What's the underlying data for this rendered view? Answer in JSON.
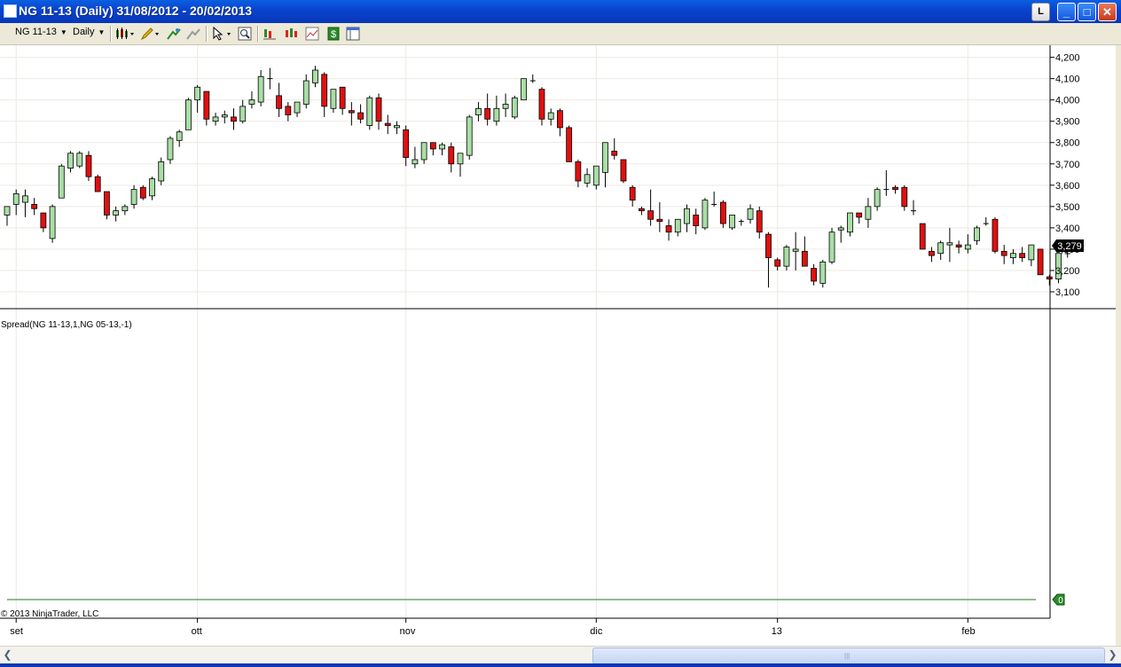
{
  "window": {
    "title": "NG 11-13 (Daily)  31/08/2012 - 20/02/2013",
    "l_button": "L",
    "minimize_glyph": "_",
    "maximize_glyph": "□",
    "close_glyph": "✕"
  },
  "toolbar": {
    "instrument": "NG 11-13",
    "interval": "Daily",
    "icons": [
      "candlestick-chart-icon",
      "pencil-draw-icon",
      "add-indicator-icon",
      "strategy-icon",
      "cursor-pointer-icon",
      "zoom-icon",
      "data-series-icon",
      "indicators-icon",
      "strategies-icon",
      "dollar-icon",
      "properties-icon"
    ]
  },
  "panels": {
    "spread_label": "Spread(NG 11-13,1,NG 05-13,-1)",
    "copyright": "© 2013 NinjaTrader, LLC",
    "spread_zero_label": "0"
  },
  "colors": {
    "up_candle": "#a9dea6",
    "down_candle": "#e01010",
    "spread_line": "#1f7a1f",
    "last_price_bg": "#000000",
    "titlebar": "#0a44d0"
  },
  "chart_data": {
    "type": "candlestick",
    "ylim": [
      3050,
      4240
    ],
    "y_ticks": [
      "4,200",
      "4,100",
      "4,000",
      "3,900",
      "3,800",
      "3,700",
      "3,600",
      "3,500",
      "3,400",
      "3,300",
      "3,200",
      "3,100"
    ],
    "y_tick_values": [
      4200,
      4100,
      4000,
      3900,
      3800,
      3700,
      3600,
      3500,
      3400,
      3300,
      3200,
      3100
    ],
    "last_price": 3279,
    "last_price_label": "3,279",
    "x_labels": [
      "set",
      "ott",
      "nov",
      "dic",
      "13",
      "feb"
    ],
    "x_label_bar_index": [
      1,
      21,
      44,
      65,
      85,
      106
    ],
    "candles": [
      [
        3460,
        3500,
        3410,
        3500
      ],
      [
        3510,
        3580,
        3460,
        3560
      ],
      [
        3520,
        3580,
        3450,
        3550
      ],
      [
        3510,
        3540,
        3460,
        3490
      ],
      [
        3470,
        3470,
        3380,
        3400
      ],
      [
        3350,
        3510,
        3330,
        3500
      ],
      [
        3540,
        3700,
        3540,
        3690
      ],
      [
        3680,
        3760,
        3660,
        3750
      ],
      [
        3690,
        3760,
        3680,
        3750
      ],
      [
        3740,
        3760,
        3620,
        3640
      ],
      [
        3640,
        3650,
        3570,
        3570
      ],
      [
        3570,
        3570,
        3440,
        3460
      ],
      [
        3460,
        3500,
        3430,
        3480
      ],
      [
        3480,
        3510,
        3460,
        3500
      ],
      [
        3510,
        3600,
        3490,
        3580
      ],
      [
        3590,
        3600,
        3530,
        3540
      ],
      [
        3550,
        3640,
        3530,
        3630
      ],
      [
        3620,
        3730,
        3600,
        3710
      ],
      [
        3720,
        3830,
        3700,
        3820
      ],
      [
        3810,
        3860,
        3780,
        3850
      ],
      [
        3860,
        4010,
        3860,
        4000
      ],
      [
        4000,
        4070,
        3940,
        4060
      ],
      [
        4040,
        4040,
        3880,
        3910
      ],
      [
        3900,
        3940,
        3880,
        3920
      ],
      [
        3920,
        3950,
        3890,
        3930
      ],
      [
        3920,
        3960,
        3860,
        3900
      ],
      [
        3900,
        4000,
        3890,
        3970
      ],
      [
        3980,
        4040,
        3960,
        4000
      ],
      [
        3990,
        4140,
        3970,
        4110
      ],
      [
        4100,
        4150,
        4050,
        4100
      ],
      [
        4020,
        4080,
        3920,
        3960
      ],
      [
        3970,
        3990,
        3900,
        3930
      ],
      [
        3940,
        3990,
        3920,
        3990
      ],
      [
        3980,
        4120,
        3960,
        4090
      ],
      [
        4080,
        4160,
        4060,
        4140
      ],
      [
        4120,
        4130,
        3920,
        3970
      ],
      [
        3960,
        4050,
        3940,
        4050
      ],
      [
        4060,
        4060,
        3930,
        3960
      ],
      [
        3950,
        3990,
        3880,
        3940
      ],
      [
        3940,
        3980,
        3890,
        3910
      ],
      [
        3880,
        4020,
        3860,
        4010
      ],
      [
        4010,
        4030,
        3860,
        3900
      ],
      [
        3890,
        3930,
        3840,
        3880
      ],
      [
        3870,
        3900,
        3840,
        3880
      ],
      [
        3860,
        3880,
        3690,
        3730
      ],
      [
        3700,
        3780,
        3680,
        3720
      ],
      [
        3720,
        3800,
        3700,
        3800
      ],
      [
        3800,
        3800,
        3740,
        3770
      ],
      [
        3770,
        3800,
        3740,
        3790
      ],
      [
        3780,
        3800,
        3660,
        3700
      ],
      [
        3700,
        3740,
        3640,
        3750
      ],
      [
        3740,
        3930,
        3720,
        3920
      ],
      [
        3930,
        3990,
        3900,
        3960
      ],
      [
        3960,
        4030,
        3880,
        3910
      ],
      [
        3900,
        4020,
        3880,
        3960
      ],
      [
        3960,
        4030,
        3920,
        3980
      ],
      [
        3920,
        4020,
        3910,
        4010
      ],
      [
        4000,
        4100,
        4000,
        4100
      ],
      [
        4090,
        4120,
        4080,
        4090
      ],
      [
        4050,
        4060,
        3880,
        3910
      ],
      [
        3910,
        3960,
        3880,
        3940
      ],
      [
        3950,
        3960,
        3830,
        3870
      ],
      [
        3870,
        3880,
        3710,
        3710
      ],
      [
        3710,
        3720,
        3590,
        3620
      ],
      [
        3610,
        3680,
        3590,
        3650
      ],
      [
        3600,
        3690,
        3580,
        3690
      ],
      [
        3660,
        3790,
        3590,
        3800
      ],
      [
        3760,
        3820,
        3720,
        3740
      ],
      [
        3720,
        3720,
        3610,
        3620
      ],
      [
        3590,
        3600,
        3500,
        3530
      ],
      [
        3490,
        3500,
        3460,
        3480
      ],
      [
        3480,
        3580,
        3410,
        3440
      ],
      [
        3440,
        3520,
        3380,
        3430
      ],
      [
        3410,
        3440,
        3340,
        3380
      ],
      [
        3380,
        3440,
        3360,
        3440
      ],
      [
        3420,
        3510,
        3380,
        3490
      ],
      [
        3460,
        3490,
        3370,
        3410
      ],
      [
        3400,
        3540,
        3390,
        3530
      ],
      [
        3510,
        3570,
        3500,
        3510
      ],
      [
        3520,
        3530,
        3400,
        3420
      ],
      [
        3400,
        3450,
        3390,
        3460
      ],
      [
        3430,
        3440,
        3410,
        3430
      ],
      [
        3440,
        3510,
        3420,
        3490
      ],
      [
        3480,
        3500,
        3350,
        3380
      ],
      [
        3370,
        3380,
        3120,
        3260
      ],
      [
        3250,
        3260,
        3200,
        3220
      ],
      [
        3220,
        3320,
        3200,
        3310
      ],
      [
        3290,
        3380,
        3200,
        3300
      ],
      [
        3290,
        3360,
        3240,
        3220
      ],
      [
        3210,
        3230,
        3130,
        3150
      ],
      [
        3140,
        3250,
        3120,
        3240
      ],
      [
        3240,
        3400,
        3230,
        3380
      ],
      [
        3390,
        3410,
        3330,
        3400
      ],
      [
        3380,
        3470,
        3360,
        3470
      ],
      [
        3470,
        3470,
        3420,
        3450
      ],
      [
        3440,
        3540,
        3400,
        3500
      ],
      [
        3500,
        3590,
        3480,
        3580
      ],
      [
        3580,
        3670,
        3550,
        3580
      ],
      [
        3590,
        3600,
        3560,
        3580
      ],
      [
        3590,
        3600,
        3480,
        3500
      ],
      [
        3480,
        3530,
        3460,
        3480
      ],
      [
        3420,
        3420,
        3330,
        3300
      ],
      [
        3290,
        3310,
        3240,
        3270
      ],
      [
        3280,
        3340,
        3250,
        3330
      ],
      [
        3320,
        3400,
        3240,
        3330
      ],
      [
        3320,
        3340,
        3280,
        3310
      ],
      [
        3300,
        3370,
        3280,
        3320
      ],
      [
        3340,
        3410,
        3320,
        3400
      ],
      [
        3420,
        3450,
        3410,
        3420
      ],
      [
        3440,
        3450,
        3280,
        3290
      ],
      [
        3290,
        3320,
        3230,
        3270
      ],
      [
        3260,
        3300,
        3230,
        3280
      ],
      [
        3280,
        3310,
        3240,
        3260
      ],
      [
        3250,
        3320,
        3220,
        3320
      ],
      [
        3300,
        3300,
        3190,
        3180
      ],
      [
        3170,
        3180,
        3130,
        3160
      ],
      [
        3160,
        3280,
        3140,
        3280
      ],
      [
        3279,
        3310,
        3260,
        3279
      ]
    ]
  }
}
